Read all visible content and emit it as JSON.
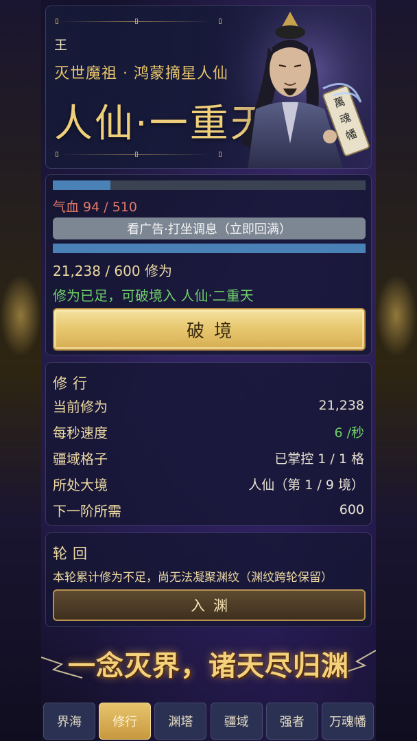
{
  "hero": {
    "player_name": "王",
    "player_title": "灭世魔祖 · 鸿蒙摘星人仙",
    "realm": "人仙·一重天",
    "banner_text": "萬魂幡"
  },
  "stats": {
    "hp_fraction": 0.184,
    "hp_text": "气血 94 / 510",
    "ad_button_label": "看广告·打坐调息（立即回满）",
    "cultivation_fraction": 1.0,
    "cultivation_text": "21,238 / 600 修为",
    "ready_text": "修为已足，可破境入 人仙·二重天",
    "breakthrough_label": "破境"
  },
  "practice": {
    "title": "修行",
    "rows": [
      {
        "label": "当前修为",
        "value": "21,238"
      },
      {
        "label": "每秒速度",
        "value": "6 /秒"
      },
      {
        "label": "疆域格子",
        "value": "已掌控 1 / 1 格"
      },
      {
        "label": "所处大境",
        "value": "人仙（第 1 / 9 境）"
      },
      {
        "label": "下一阶所需",
        "value": "600"
      }
    ]
  },
  "reincarnation": {
    "title": "轮回",
    "note": "本轮累计修为不足，尚无法凝聚渊纹（渊纹跨轮保留）",
    "button_label": "入渊"
  },
  "slogan": "一念灭界，诸天尽归渊",
  "nav": {
    "items": [
      {
        "label": "界海",
        "active": false
      },
      {
        "label": "修行",
        "active": true
      },
      {
        "label": "渊塔",
        "active": false
      },
      {
        "label": "疆域",
        "active": false
      },
      {
        "label": "强者",
        "active": false
      },
      {
        "label": "万魂幡",
        "active": false
      }
    ]
  },
  "colors": {
    "accent_gold": "#e8c46a",
    "hp_red": "#e07a6a",
    "ok_green": "#6fcf6a",
    "bar_blue": "#4a82b8"
  }
}
